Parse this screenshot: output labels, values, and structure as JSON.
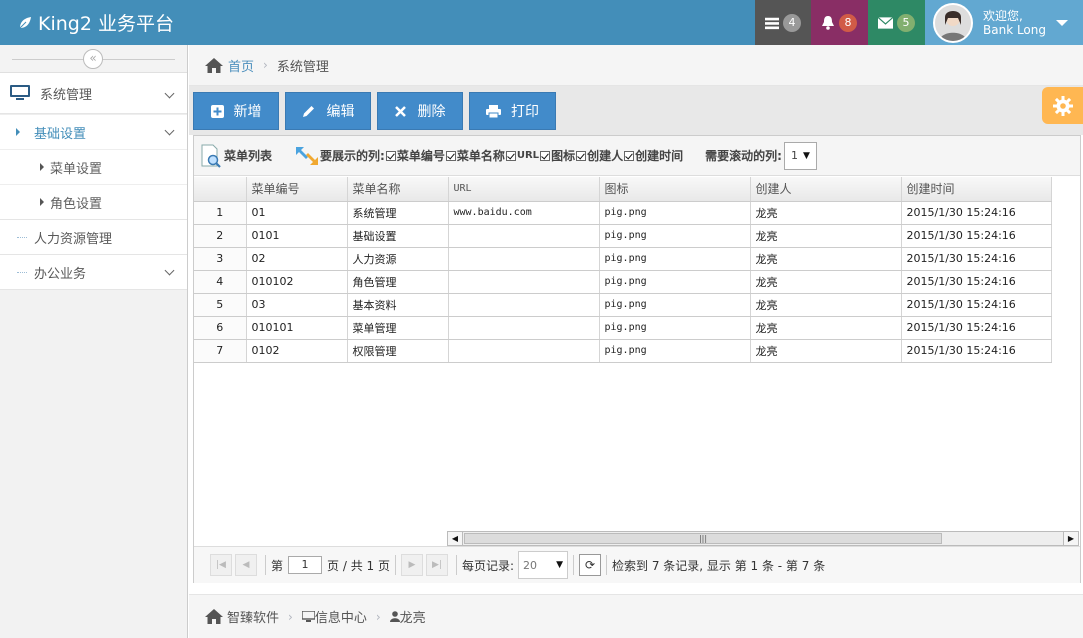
{
  "app": {
    "title": "King2 业务平台"
  },
  "navbar": {
    "tasks_count": "4",
    "notifications_count": "8",
    "messages_count": "5",
    "user_greeting": "欢迎您,",
    "user_name": "Bank Long"
  },
  "sidebar": {
    "items": [
      {
        "label": "系统管理"
      },
      {
        "label": "基础设置"
      },
      {
        "label": "菜单设置"
      },
      {
        "label": "角色设置"
      },
      {
        "label": "人力资源管理"
      },
      {
        "label": "办公业务"
      }
    ]
  },
  "breadcrumb": {
    "home": "首页",
    "current": "系统管理"
  },
  "toolbar": {
    "add_label": "新增",
    "edit_label": "编辑",
    "delete_label": "删除",
    "print_label": "打印"
  },
  "grid": {
    "title": "菜单列表",
    "columns_label": "要展示的列:",
    "column_options": [
      "菜单编号",
      "菜单名称",
      "URL",
      "图标",
      "创建人",
      "创建时间"
    ],
    "scroll_label": "需要滚动的列:",
    "scroll_value": "1",
    "headers": [
      "",
      "菜单编号",
      "菜单名称",
      "URL",
      "图标",
      "创建人",
      "创建时间"
    ],
    "rows": [
      [
        "1",
        "01",
        "系统管理",
        "www.baidu.com",
        "pig.png",
        "龙亮",
        "2015/1/30 15:24:16"
      ],
      [
        "2",
        "0101",
        "基础设置",
        "",
        "pig.png",
        "龙亮",
        "2015/1/30 15:24:16"
      ],
      [
        "3",
        "02",
        "人力资源",
        "",
        "pig.png",
        "龙亮",
        "2015/1/30 15:24:16"
      ],
      [
        "4",
        "010102",
        "角色管理",
        "",
        "pig.png",
        "龙亮",
        "2015/1/30 15:24:16"
      ],
      [
        "5",
        "03",
        "基本资料",
        "",
        "pig.png",
        "龙亮",
        "2015/1/30 15:24:16"
      ],
      [
        "6",
        "010101",
        "菜单管理",
        "",
        "pig.png",
        "龙亮",
        "2015/1/30 15:24:16"
      ],
      [
        "7",
        "0102",
        "权限管理",
        "",
        "pig.png",
        "龙亮",
        "2015/1/30 15:24:16"
      ]
    ]
  },
  "pager": {
    "page_prefix": "第",
    "page_value": "1",
    "page_suffix": "页 / 共 1 页",
    "per_page_label": "每页记录:",
    "per_page_value": "20",
    "summary": "检索到 7 条记录, 显示 第 1 条 - 第 7 条"
  },
  "footer": {
    "company": "智臻软件",
    "center": "信息中心",
    "user": "龙亮"
  },
  "colors": {
    "navbar": "#438eb9",
    "button": "#428bca",
    "settings": "#ffb752"
  }
}
